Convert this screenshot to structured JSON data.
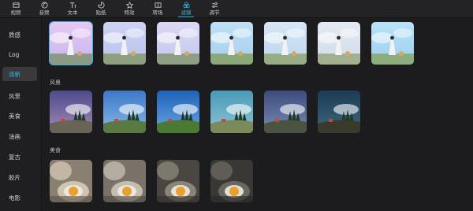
{
  "toolbar": {
    "tools": [
      {
        "label": "视频",
        "icon": "video-icon"
      },
      {
        "label": "音频",
        "icon": "audio-icon"
      },
      {
        "label": "文本",
        "icon": "text-icon"
      },
      {
        "label": "贴纸",
        "icon": "sticker-icon"
      },
      {
        "label": "特效",
        "icon": "effects-icon"
      },
      {
        "label": "转场",
        "icon": "transition-icon"
      },
      {
        "label": "滤镜",
        "icon": "filter-icon",
        "active": true
      },
      {
        "label": "调节",
        "icon": "adjust-icon"
      }
    ]
  },
  "sidebar": {
    "items": [
      {
        "label": "质感"
      },
      {
        "label": "Log"
      },
      {
        "label": "清新",
        "active": true
      },
      {
        "label": "风景"
      },
      {
        "label": "美食"
      },
      {
        "label": "油画"
      },
      {
        "label": "复古"
      },
      {
        "label": "胶片"
      },
      {
        "label": "电影"
      }
    ]
  },
  "sections": [
    {
      "label": "",
      "count": 7,
      "theme": "fresh"
    },
    {
      "label": "风景",
      "count": 6,
      "theme": "landscape"
    },
    {
      "label": "美食",
      "count": 4,
      "theme": "food"
    }
  ],
  "colors": {
    "accent": "#2fb8e6",
    "background": "#1c1c1e"
  }
}
